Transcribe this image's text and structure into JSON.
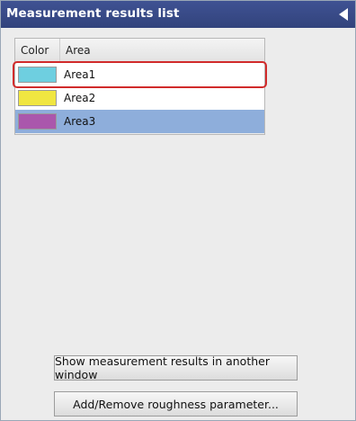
{
  "panel": {
    "title": "Measurement results list"
  },
  "table": {
    "columns": [
      "Color",
      "Area"
    ],
    "rows": [
      {
        "color": "#6ecfe0",
        "label": "Area1"
      },
      {
        "color": "#f0e641",
        "label": "Area2"
      },
      {
        "color": "#aa57ac",
        "label": "Area3"
      }
    ]
  },
  "buttons": {
    "show_results": "Show measurement results in another window",
    "add_remove": "Add/Remove roughness parameter..."
  },
  "colors": {
    "titlebar": "#3a4b89",
    "selected_row": "#8eaedb",
    "highlight": "#d12b2b"
  }
}
